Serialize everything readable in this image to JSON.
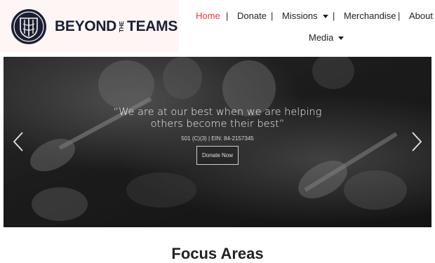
{
  "brand": {
    "logo_icon": "anchor-shield-icon",
    "word1": "BEYOND",
    "word2": "THE",
    "word3": "TEAMS"
  },
  "nav": {
    "home": "Home",
    "donate": "Donate",
    "missions": "Missions",
    "merchandise": "Merchandise",
    "about": "About U",
    "media": "Media",
    "separator": "|",
    "active_color": "#e8392b"
  },
  "hero": {
    "quote": "“We are at our best when we are helping others become their best”",
    "ein_text": "501 (C)(3) | EIN: 84-2157345",
    "donate_button": "Donate Now",
    "prev_icon": "chevron-left-icon",
    "next_icon": "chevron-right-icon"
  },
  "section": {
    "title": "Focus Areas"
  }
}
